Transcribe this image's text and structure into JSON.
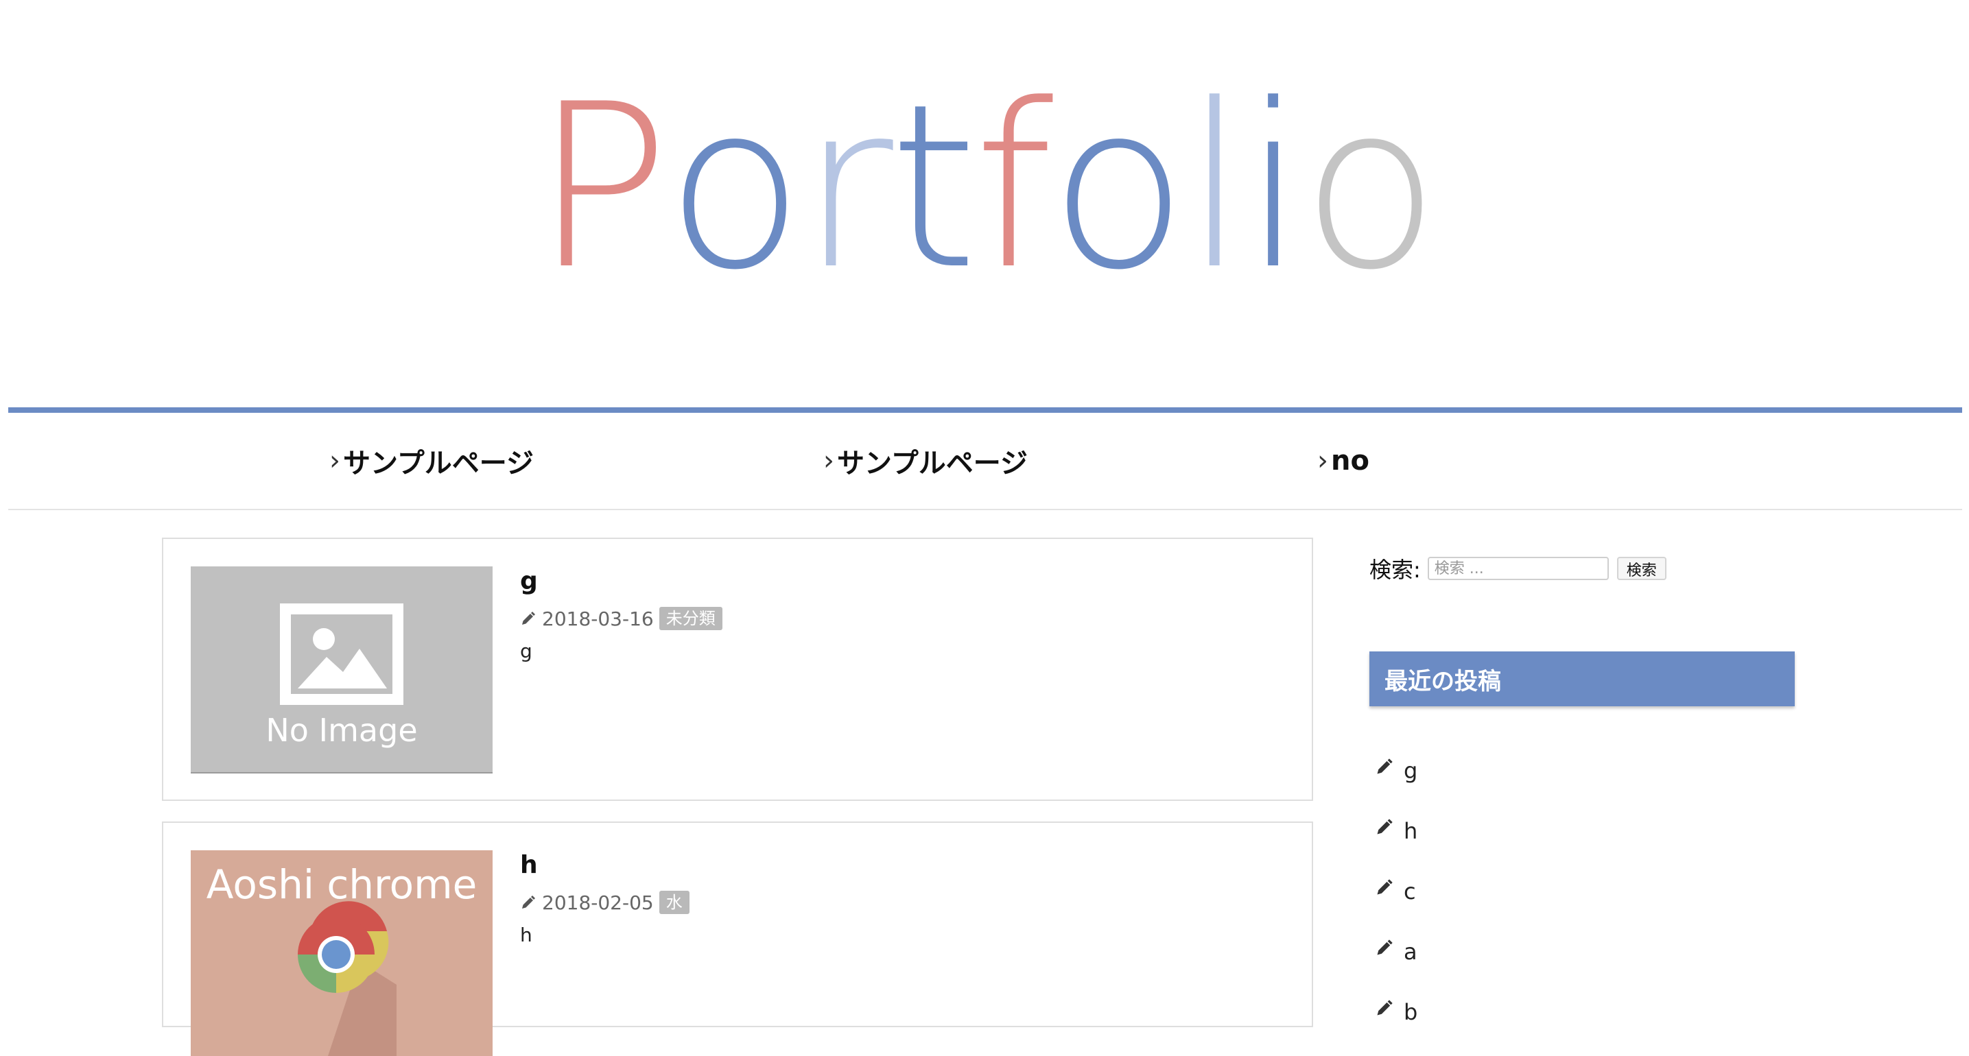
{
  "header": {
    "logo_letters": [
      {
        "char": "P",
        "color": "#e08a86"
      },
      {
        "char": "o",
        "color": "#6b8bc4"
      },
      {
        "char": "r",
        "color": "#b6c5e3"
      },
      {
        "char": "t",
        "color": "#6b8bc4"
      },
      {
        "char": "f",
        "color": "#e08a86"
      },
      {
        "char": "o",
        "color": "#6b8bc4"
      },
      {
        "char": "l",
        "color": "#b6c5e3"
      },
      {
        "char": "i",
        "color": "#6b8bc4"
      },
      {
        "char": "o",
        "color": "#c4c4c4"
      }
    ],
    "accent_color": "#6b8bc4"
  },
  "nav": {
    "items": [
      {
        "label": "サンプルページ",
        "icon": "chevron-right-icon"
      },
      {
        "label": "サンプルページ",
        "icon": "chevron-right-icon"
      },
      {
        "label": "no",
        "icon": "chevron-right-icon"
      }
    ]
  },
  "posts": [
    {
      "title": "g",
      "date": "2018-03-16",
      "category": "未分類",
      "excerpt": "g",
      "thumbnail": {
        "type": "placeholder",
        "text": "No Image",
        "icon": "image-icon"
      }
    },
    {
      "title": "h",
      "date": "2018-02-05",
      "category": "水",
      "excerpt": "h",
      "thumbnail": {
        "type": "image",
        "text": "Aoshi chrome",
        "icon": "chrome-logo-icon"
      }
    }
  ],
  "sidebar": {
    "search": {
      "label": "検索:",
      "placeholder": "検索 ...",
      "button_label": "検索"
    },
    "recent_posts": {
      "title": "最近の投稿",
      "items": [
        "g",
        "h",
        "c",
        "a",
        "b"
      ]
    }
  }
}
